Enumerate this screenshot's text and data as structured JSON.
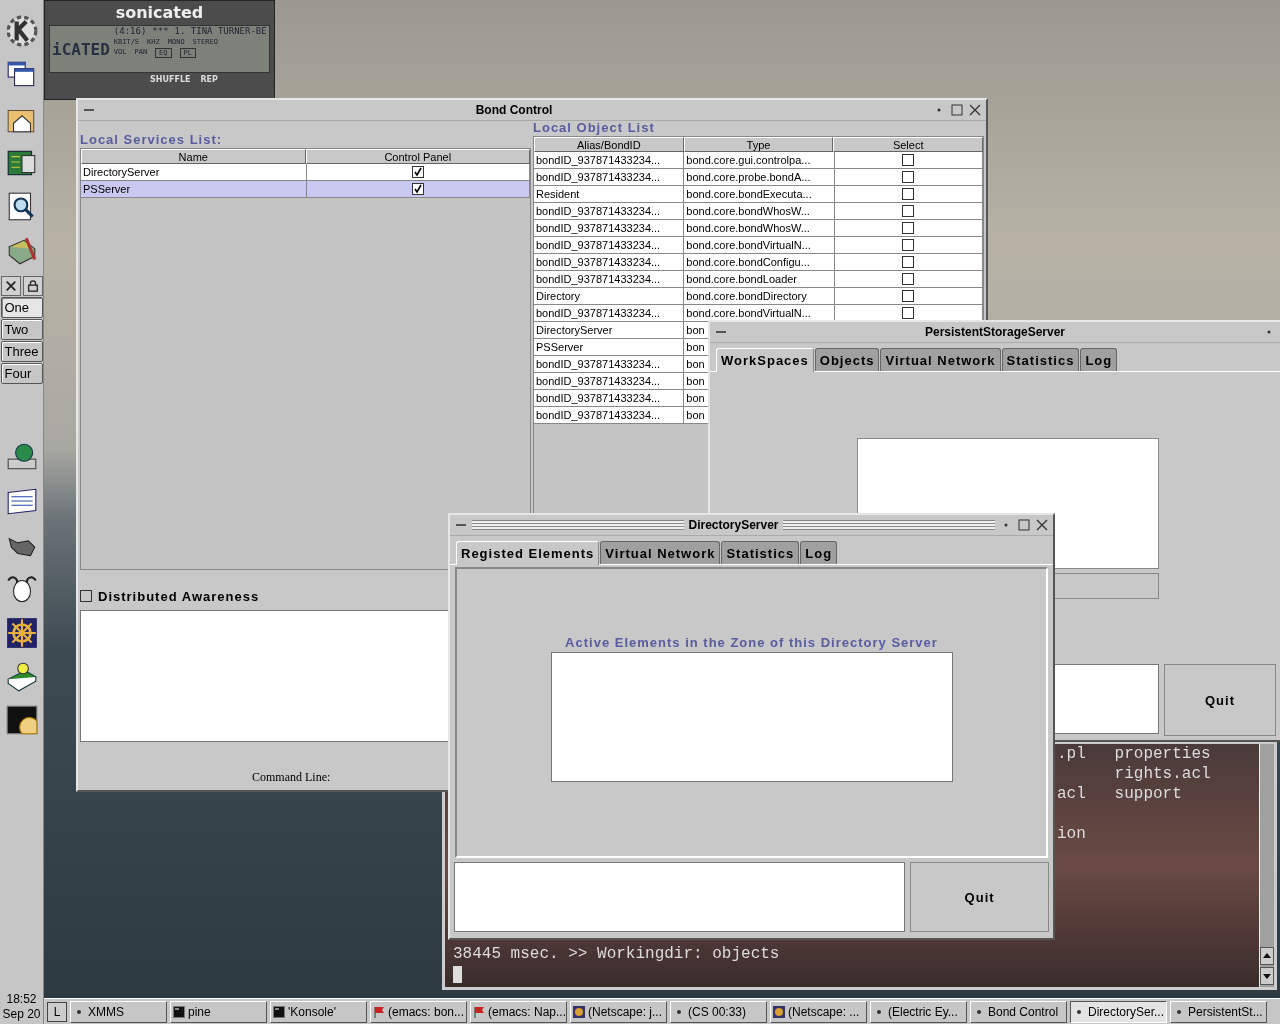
{
  "player": {
    "title": "sonicated",
    "time": "(4:16)",
    "rating": "***",
    "track": "1. TINA TURNER-BE",
    "logo": "iCATED",
    "bitrate_label": "KBIT/S",
    "rate_label": "KHZ",
    "mono": "MONO",
    "stereo": "STEREO",
    "vol": "VOL",
    "pan": "PAN",
    "eq": "EQ",
    "pl": "PL",
    "shuffle": "SHUFFLE",
    "rep": "REP"
  },
  "panel": {
    "desktops": [
      {
        "label": "One",
        "selected": true
      },
      {
        "label": "Two",
        "selected": false
      },
      {
        "label": "Three",
        "selected": false
      },
      {
        "label": "Four",
        "selected": false
      }
    ],
    "clock": {
      "time": "18:52",
      "date": "Sep 20"
    }
  },
  "bond_control": {
    "title": "Bond Control",
    "services_label": "Local Services List:",
    "services_columns": [
      "Name",
      "Control Panel"
    ],
    "services": [
      {
        "name": "DirectoryServer",
        "checked": true,
        "selected": false
      },
      {
        "name": "PSServer",
        "checked": true,
        "selected": true
      }
    ],
    "awareness": {
      "label": "Distributed Awareness",
      "checked": false
    },
    "command_label": "Command Line:",
    "objects_label": "Local Object List",
    "objects_columns": [
      "Alias/BondID",
      "Type",
      "Select"
    ],
    "objects": [
      {
        "alias": "bondID_937871433234...",
        "type": "bond.core.gui.controlpa...",
        "checked": false
      },
      {
        "alias": "bondID_937871433234...",
        "type": "bond.core.probe.bondA...",
        "checked": false
      },
      {
        "alias": "Resident",
        "type": "bond.core.bondExecuta...",
        "checked": false
      },
      {
        "alias": "bondID_937871433234...",
        "type": "bond.core.bondWhosW...",
        "checked": false
      },
      {
        "alias": "bondID_937871433234...",
        "type": "bond.core.bondWhosW...",
        "checked": false
      },
      {
        "alias": "bondID_937871433234...",
        "type": "bond.core.bondVirtualN...",
        "checked": false
      },
      {
        "alias": "bondID_937871433234...",
        "type": "bond.core.bondConfigu...",
        "checked": false
      },
      {
        "alias": "bondID_937871433234...",
        "type": "bond.core.bondLoader",
        "checked": false
      },
      {
        "alias": "Directory",
        "type": "bond.core.bondDirectory",
        "checked": false
      },
      {
        "alias": "bondID_937871433234...",
        "type": "bond.core.bondVirtualN...",
        "checked": false
      },
      {
        "alias": "DirectoryServer",
        "type": "bon"
      },
      {
        "alias": "PSServer",
        "type": "bon"
      },
      {
        "alias": "bondID_937871433234...",
        "type": "bon"
      },
      {
        "alias": "bondID_937871433234...",
        "type": "bon"
      },
      {
        "alias": "bondID_937871433234...",
        "type": "bon"
      },
      {
        "alias": "bondID_937871433234...",
        "type": "bon"
      }
    ]
  },
  "persistent_storage_server": {
    "title": "PersistentStorageServer",
    "tabs": [
      {
        "label": "WorkSpaces",
        "selected": true
      },
      {
        "label": "Objects",
        "selected": false
      },
      {
        "label": "Virtual Network",
        "selected": false
      },
      {
        "label": "Statistics",
        "selected": false
      },
      {
        "label": "Log",
        "selected": false
      }
    ],
    "quit": "Quit"
  },
  "directory_server": {
    "title": "DirectoryServer",
    "tabs": [
      {
        "label": "Registed Elements",
        "selected": true
      },
      {
        "label": "Virtual Network",
        "selected": false
      },
      {
        "label": "Statistics",
        "selected": false
      },
      {
        "label": "Log",
        "selected": false
      }
    ],
    "list_label": "Active Elements in the Zone of this Directory Server",
    "quit": "Quit"
  },
  "terminal": {
    "listing": ".pl   properties\n      rights.acl\nacl   support\n\nion",
    "prompt": "38445 msec. >> Workingdir: objects"
  },
  "taskbar": {
    "button": "L",
    "tasks": [
      {
        "label": "XMMS",
        "kind": "dot",
        "selected": false
      },
      {
        "label": "pine",
        "kind": "terminal",
        "selected": false
      },
      {
        "label": "'Konsole'",
        "kind": "terminal",
        "selected": false
      },
      {
        "label": "(emacs: bon...",
        "kind": "flag",
        "selected": false
      },
      {
        "label": "(emacs: Nap...",
        "kind": "flag",
        "selected": false
      },
      {
        "label": "(Netscape: j...",
        "kind": "browser",
        "selected": false
      },
      {
        "label": "(CS 00:33)",
        "kind": "dot",
        "selected": false
      },
      {
        "label": "(Netscape: ...",
        "kind": "browser",
        "selected": false
      },
      {
        "label": "(Electric Ey...",
        "kind": "dot",
        "selected": false
      },
      {
        "label": "Bond Control",
        "kind": "dot",
        "selected": false
      },
      {
        "label": "DirectorySer...",
        "kind": "dot",
        "selected": true
      },
      {
        "label": "PersistentSt...",
        "kind": "dot",
        "selected": false
      }
    ]
  }
}
